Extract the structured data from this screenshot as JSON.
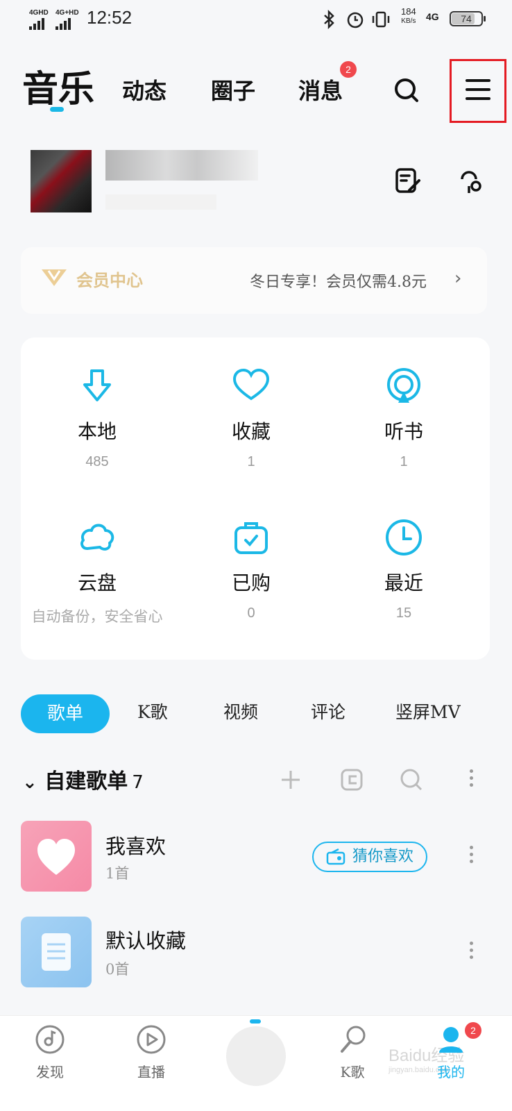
{
  "status_bar": {
    "sig1": "4GHD",
    "sig2": "4G+HD",
    "time": "12:52",
    "net_speed": "184",
    "net_unit": "KB/s",
    "net_type": "4G",
    "battery": "74"
  },
  "top_nav": {
    "tabs": [
      {
        "label": "音乐",
        "active": true
      },
      {
        "label": "动态"
      },
      {
        "label": "圈子"
      },
      {
        "label": "消息",
        "badge": "2"
      }
    ],
    "icons": [
      "search-icon",
      "menu-icon"
    ]
  },
  "profile": {
    "icons": [
      "edit-icon",
      "voice-icon"
    ]
  },
  "vip": {
    "title": "会员中心",
    "promo": "冬日专享！会员仅需4.8元",
    "chevron": "›"
  },
  "grid": {
    "items": [
      {
        "label": "本地",
        "count": "485",
        "icon": "download-icon"
      },
      {
        "label": "收藏",
        "count": "1",
        "icon": "heart-icon"
      },
      {
        "label": "听书",
        "count": "1",
        "icon": "audiobook-icon"
      },
      {
        "label": "云盘",
        "count": "自动备份，安全省心",
        "icon": "cloud-icon"
      },
      {
        "label": "已购",
        "count": "0",
        "icon": "bag-icon"
      },
      {
        "label": "最近",
        "count": "15",
        "icon": "clock-icon"
      }
    ]
  },
  "sub_tabs": [
    "歌单",
    "K歌",
    "视频",
    "评论",
    "竖屏MV"
  ],
  "playlists": {
    "header": "自建歌单",
    "count": "7",
    "rows": [
      {
        "title": "我喜欢",
        "sub": "1首",
        "action": "猜你喜欢"
      },
      {
        "title": "默认收藏",
        "sub": "0首"
      }
    ]
  },
  "bottom_nav": {
    "items": [
      {
        "label": "发现",
        "icon": "discover-icon"
      },
      {
        "label": "直播",
        "icon": "live-icon"
      },
      {
        "label": "K歌",
        "icon": "mic-icon"
      },
      {
        "label": "我的",
        "icon": "profile-icon",
        "active": true,
        "badge": "2"
      }
    ]
  },
  "watermark": {
    "brand": "Baidu经验",
    "url": "jingyan.baidu.com"
  },
  "colors": {
    "accent": "#1bb5ee",
    "badge": "#f0484d",
    "vip_gold": "#d8b26a",
    "highlight_box": "#e41b23"
  }
}
